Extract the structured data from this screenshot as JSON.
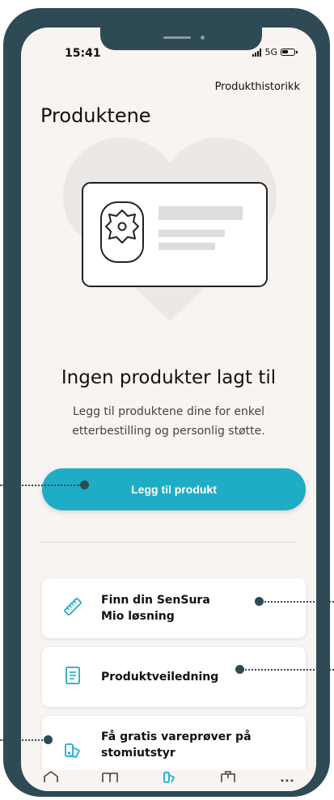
{
  "status_bar": {
    "time": "15:41",
    "network": "5G"
  },
  "header": {
    "history_link": "Produkthistorikk",
    "title": "Produktene"
  },
  "empty_state": {
    "title": "Ingen produkter lagt til",
    "description": "Legg til produktene dine for enkel etterbestilling og personlig støtte."
  },
  "add_button_label": "Legg til produkt",
  "cards": [
    {
      "label_line1": "Finn din SenSura",
      "label_line2": "Mio løsning",
      "icon": "ruler-icon"
    },
    {
      "label_line1": "Produktveiledning",
      "icon": "document-icon"
    },
    {
      "label_line1": "Få gratis vareprøver på",
      "label_line2": "stomiutstyr",
      "icon": "samples-icon"
    }
  ],
  "tab_icons": [
    "home-icon",
    "book-icon",
    "products-icon",
    "bag-icon",
    "more-icon"
  ],
  "colors": {
    "accent": "#1fadc5",
    "frame": "#2e4a55",
    "background": "#f7f4f2"
  }
}
